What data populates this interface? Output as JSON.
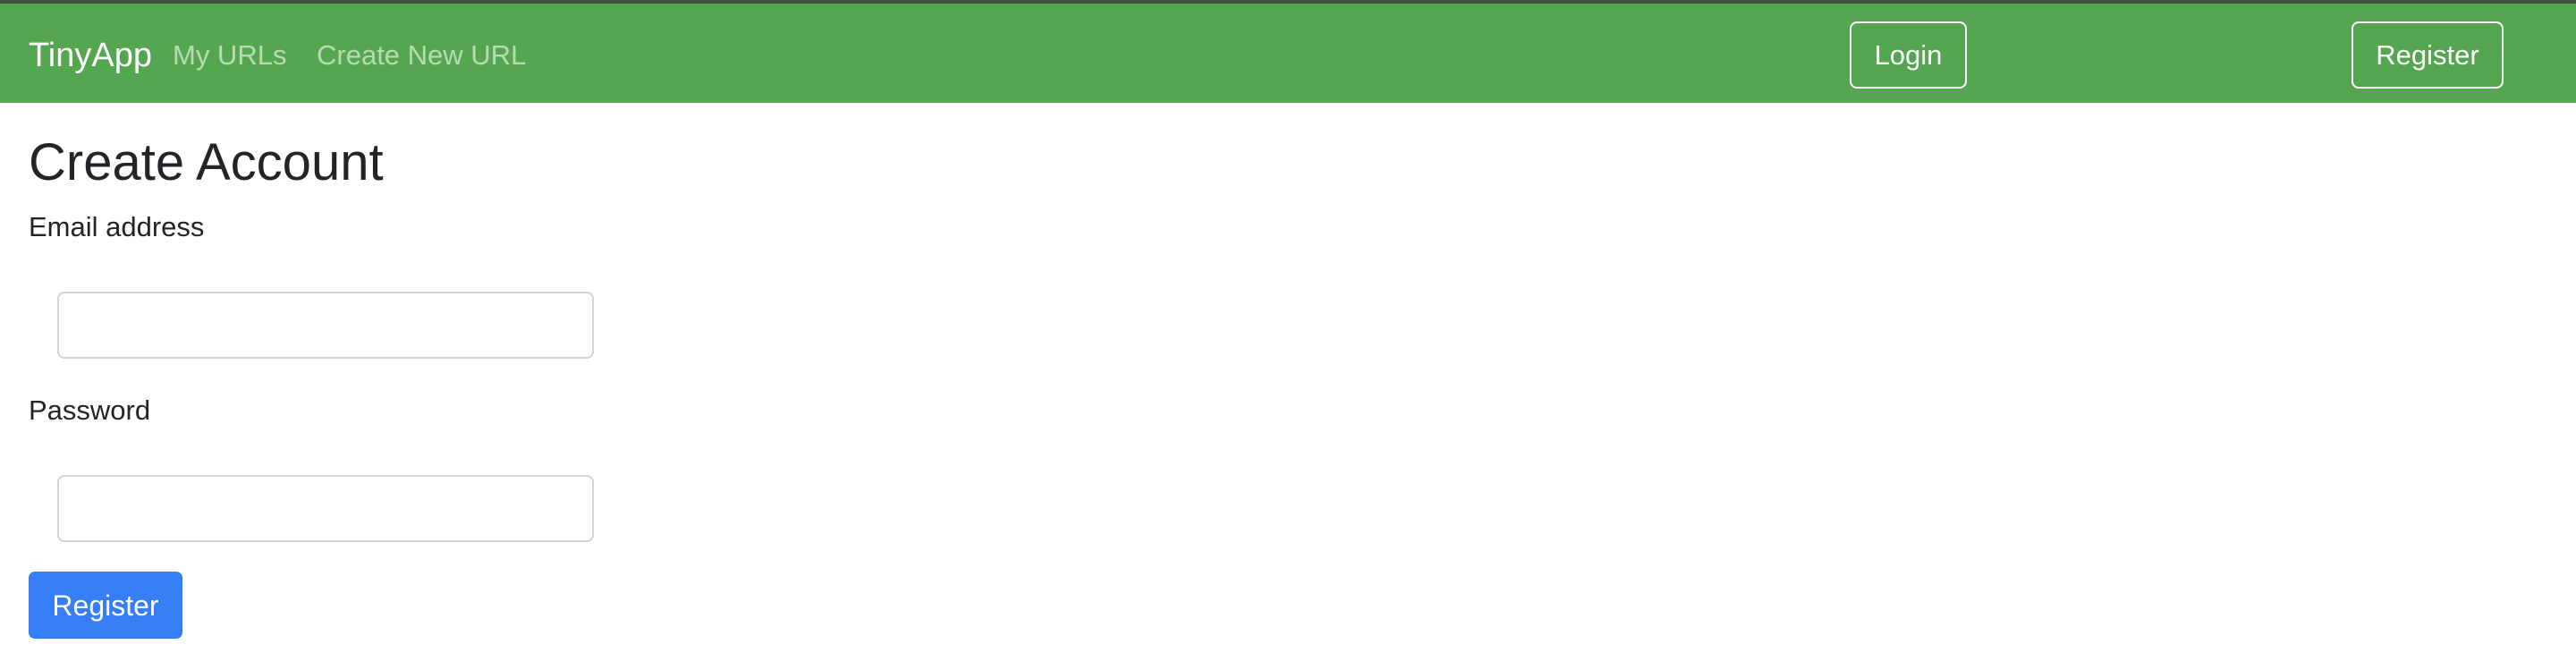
{
  "navbar": {
    "brand": "TinyApp",
    "links": [
      {
        "label": "My URLs"
      },
      {
        "label": "Create New URL"
      }
    ],
    "login_label": "Login",
    "register_label": "Register",
    "background_color": "#55a650"
  },
  "main": {
    "title": "Create Account",
    "email": {
      "label": "Email address",
      "value": "",
      "placeholder": ""
    },
    "password": {
      "label": "Password",
      "value": "",
      "placeholder": ""
    },
    "submit_label": "Register",
    "submit_color": "#367ef6"
  }
}
